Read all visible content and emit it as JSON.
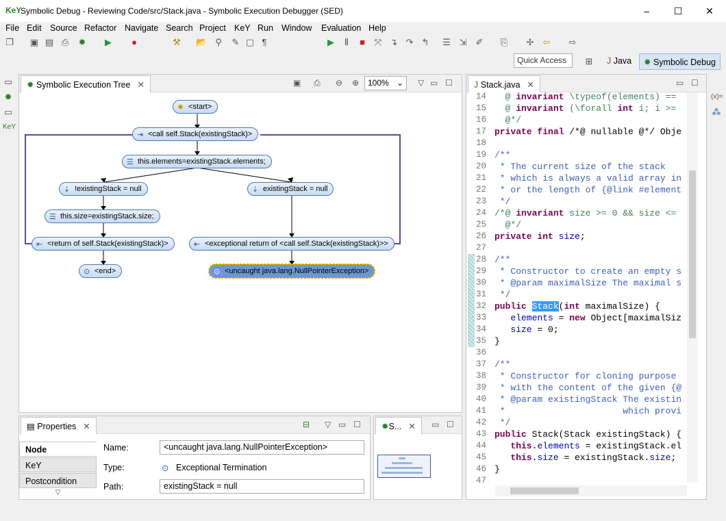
{
  "window": {
    "app_icon": "KeY",
    "title": "Symbolic Debug - Reviewing Code/src/Stack.java - Symbolic Execution Debugger (SED)",
    "minimize": "–",
    "maximize": "☐",
    "close": "✕"
  },
  "menu": [
    "File",
    "Edit",
    "Source",
    "Refactor",
    "Navigate",
    "Search",
    "Project",
    "KeY",
    "Run",
    "Window",
    "Evaluation",
    "Help"
  ],
  "toolbar": {
    "quick_access": "Quick Access",
    "perspectives": [
      "Java",
      "Symbolic Debug"
    ]
  },
  "tree_view": {
    "tab_label": "Symbolic Execution Tree",
    "zoom": "100%",
    "nodes": {
      "start": "<start>",
      "call": "<call self.Stack(existingStack)>",
      "assign_elements": "this.elements=existingStack.elements;",
      "branch_not_null": "!existingStack = null",
      "branch_null": "existingStack = null",
      "assign_size": "this.size=existingStack.size;",
      "return": "<return of self.Stack(existingStack)>",
      "exc_return": "<exceptional return of <call self.Stack(existingStack)>>",
      "end": "<end>",
      "uncaught": "<uncaught java.lang.NullPointerException>"
    }
  },
  "properties": {
    "tab_label": "Properties",
    "tabs": [
      "Node",
      "KeY",
      "Postcondition"
    ],
    "active_tab": "Node",
    "name_label": "Name:",
    "name_value": "<uncaught java.lang.NullPointerException>",
    "type_label": "Type:",
    "type_value": "Exceptional Termination",
    "path_label": "Path:",
    "path_value": "existingStack = null"
  },
  "outline": {
    "tab_label": "S..."
  },
  "editor": {
    "tab_label": "Stack.java",
    "lines": [
      {
        "n": "14",
        "t": "  @ invariant \\typeof(elements) =="
      },
      {
        "n": "15",
        "t": "  @ invariant (\\forall int i; i >="
      },
      {
        "n": "16",
        "t": "  @*/"
      },
      {
        "n": "17",
        "t": "private final /*@ nullable @*/ Obje"
      },
      {
        "n": "18",
        "t": ""
      },
      {
        "n": "19",
        "t": "/**"
      },
      {
        "n": "20",
        "t": " * The current size of the stack"
      },
      {
        "n": "21",
        "t": " * which is always a valid array in"
      },
      {
        "n": "22",
        "t": " * or the length of {@link #element"
      },
      {
        "n": "23",
        "t": " */"
      },
      {
        "n": "24",
        "t": "/*@ invariant size >= 0 && size <="
      },
      {
        "n": "25",
        "t": "  @*/"
      },
      {
        "n": "26",
        "t": "private int size;"
      },
      {
        "n": "27",
        "t": ""
      },
      {
        "n": "28",
        "t": "/**"
      },
      {
        "n": "29",
        "t": " * Constructor to create an empty s"
      },
      {
        "n": "30",
        "t": " * @param maximalSize The maximal s"
      },
      {
        "n": "31",
        "t": " */"
      },
      {
        "n": "32",
        "t": "public Stack(int maximalSize) {"
      },
      {
        "n": "33",
        "t": "   elements = new Object[maximalSiz"
      },
      {
        "n": "34",
        "t": "   size = 0;"
      },
      {
        "n": "35",
        "t": "}"
      },
      {
        "n": "36",
        "t": ""
      },
      {
        "n": "37",
        "t": "/**"
      },
      {
        "n": "38",
        "t": " * Constructor for cloning purpose"
      },
      {
        "n": "39",
        "t": " * with the content of the given {@"
      },
      {
        "n": "40",
        "t": " * @param existingStack The existin"
      },
      {
        "n": "41",
        "t": " *                      which provi"
      },
      {
        "n": "42",
        "t": " */"
      },
      {
        "n": "43",
        "t": "public Stack(Stack existingStack) {"
      },
      {
        "n": "44",
        "t": "   this.elements = existingStack.el"
      },
      {
        "n": "45",
        "t": "   this.size = existingStack.size;"
      },
      {
        "n": "46",
        "t": "}"
      },
      {
        "n": "47",
        "t": ""
      }
    ]
  },
  "right_strip": {
    "variables": "(x)="
  }
}
